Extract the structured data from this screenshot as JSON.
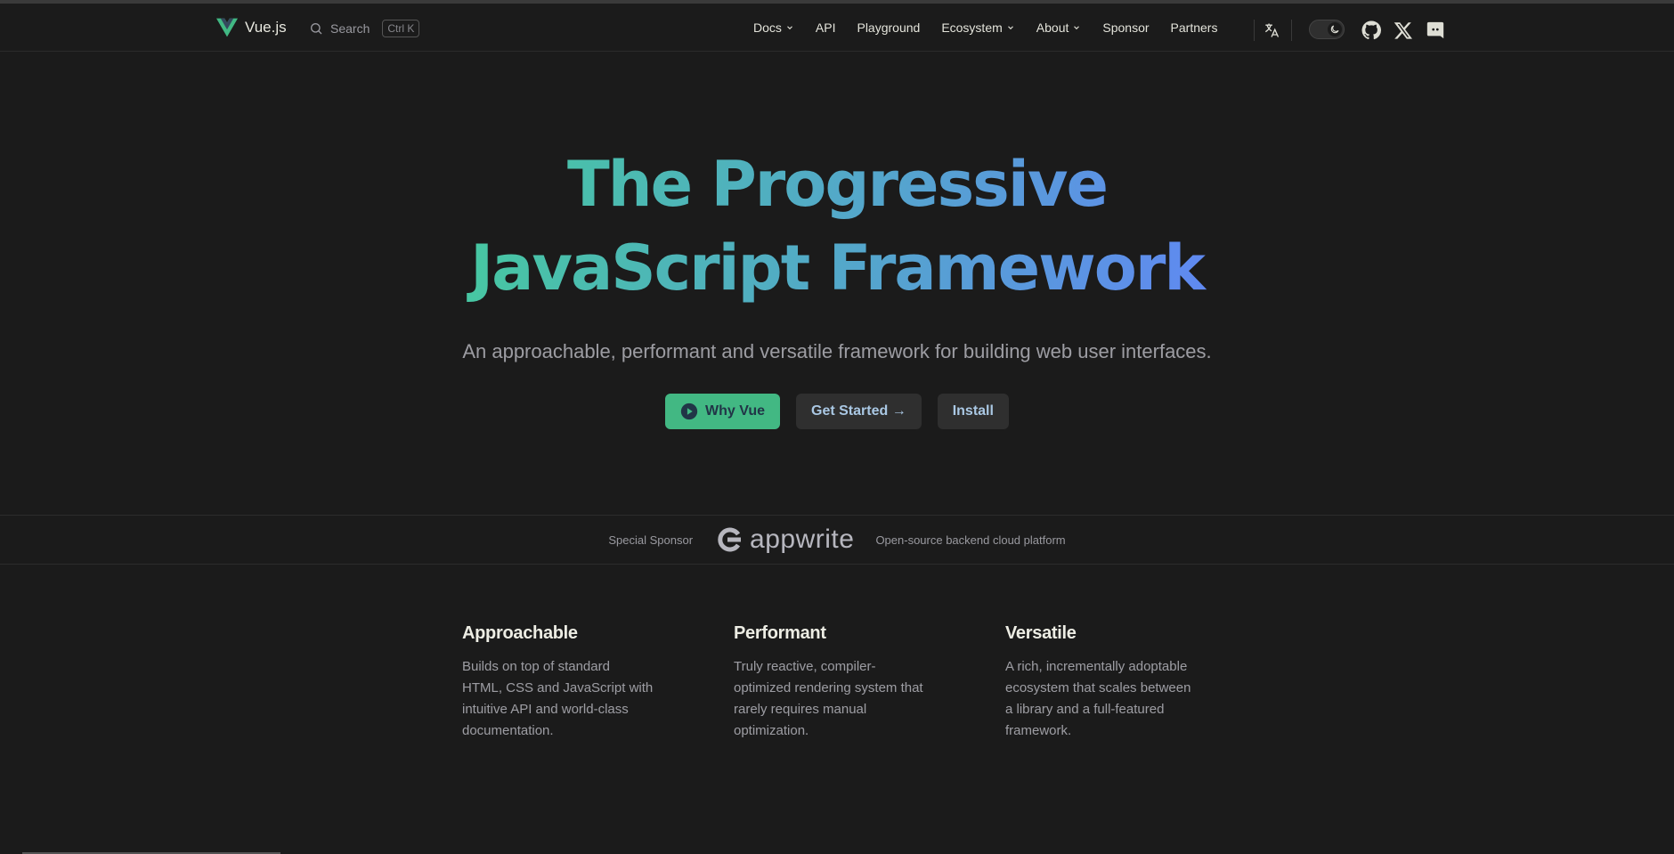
{
  "nav": {
    "brand": "Vue.js",
    "search_label": "Search",
    "search_shortcut": "Ctrl K",
    "items": [
      {
        "label": "Docs",
        "dropdown": true
      },
      {
        "label": "API",
        "dropdown": false
      },
      {
        "label": "Playground",
        "dropdown": false
      },
      {
        "label": "Ecosystem",
        "dropdown": true
      },
      {
        "label": "About",
        "dropdown": true
      },
      {
        "label": "Sponsor",
        "dropdown": false
      },
      {
        "label": "Partners",
        "dropdown": false
      }
    ],
    "icons": [
      "translate-icon",
      "theme-toggle",
      "github-icon",
      "x-icon",
      "discord-icon"
    ]
  },
  "hero": {
    "title_line1": "The Progressive",
    "title_line2": "JavaScript Framework",
    "tagline": "An approachable, performant and versatile framework for building web user interfaces.",
    "buttons": {
      "why": "Why Vue",
      "get_started": "Get Started →",
      "install": "Install"
    }
  },
  "sponsor": {
    "label": "Special Sponsor",
    "name": "appwrite",
    "description": "Open-source backend cloud platform"
  },
  "features": [
    {
      "title": "Approachable",
      "text": "Builds on top of standard HTML, CSS and JavaScript with intuitive API and world-class documentation."
    },
    {
      "title": "Performant",
      "text": "Truly reactive, compiler-optimized rendering system that rarely requires manual optimization."
    },
    {
      "title": "Versatile",
      "text": "A rich, incrementally adoptable ecosystem that scales between a library and a full-featured framework."
    }
  ],
  "colors": {
    "background": "#1b1b1b",
    "brand_green": "#42b883",
    "gradient_start": "#42d392",
    "gradient_end": "#647eff"
  }
}
